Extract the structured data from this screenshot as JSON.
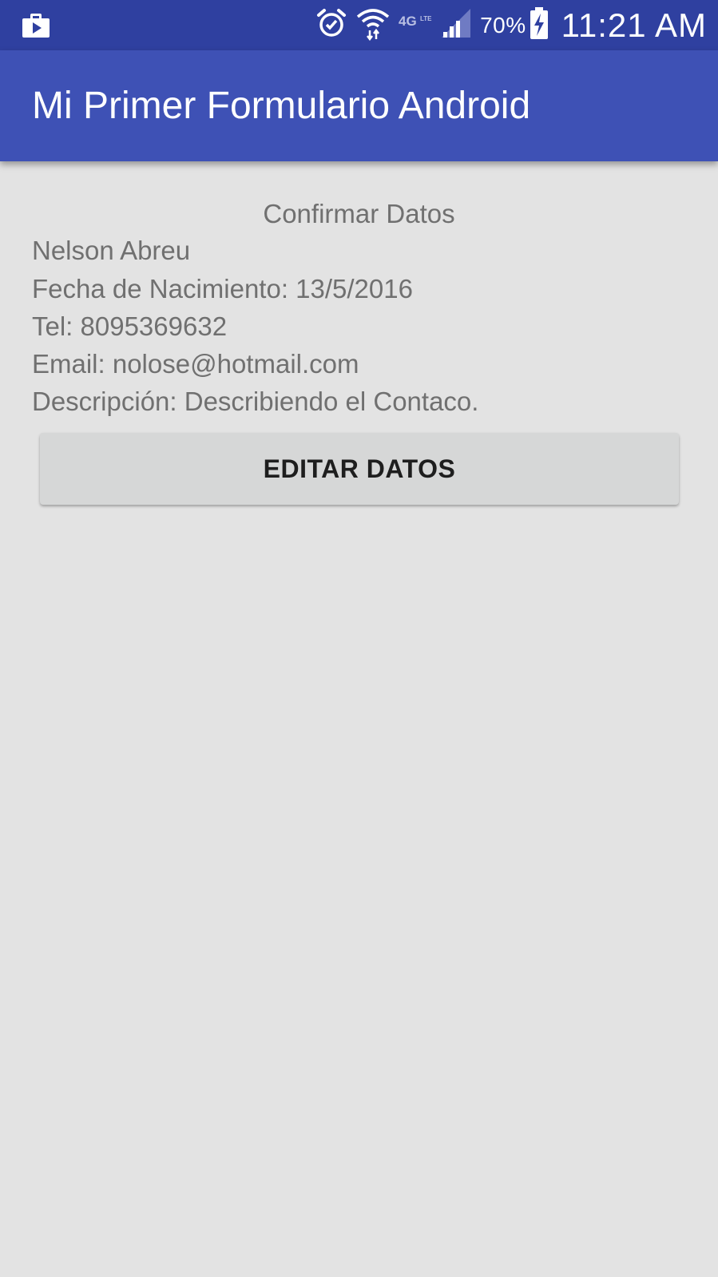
{
  "status_bar": {
    "left_icon": "work-profile-icon",
    "icons": [
      "alarm-icon",
      "wifi-icon",
      "network-4g-lte-icon",
      "signal-icon"
    ],
    "battery_percent": "70%",
    "battery_icon": "battery-charging-icon",
    "time": "11:21 AM",
    "colors": {
      "background": "#2f40a0",
      "text": "#ffffff"
    }
  },
  "app_bar": {
    "title": "Mi Primer Formulario Android",
    "color": "#3e51b5"
  },
  "confirm": {
    "heading": "Confirmar Datos",
    "name": "Nelson Abreu",
    "birthdate": "Fecha de Nacimiento: 13/5/2016",
    "phone": "Tel: 8095369632",
    "email": "Email: nolose@hotmail.com",
    "description": "Descripción: Describiendo el Contaco."
  },
  "actions": {
    "edit_label": "EDITAR DATOS"
  },
  "colors": {
    "page_background": "#e3e3e3",
    "text": "#707070",
    "button_background": "#d6d7d7"
  }
}
